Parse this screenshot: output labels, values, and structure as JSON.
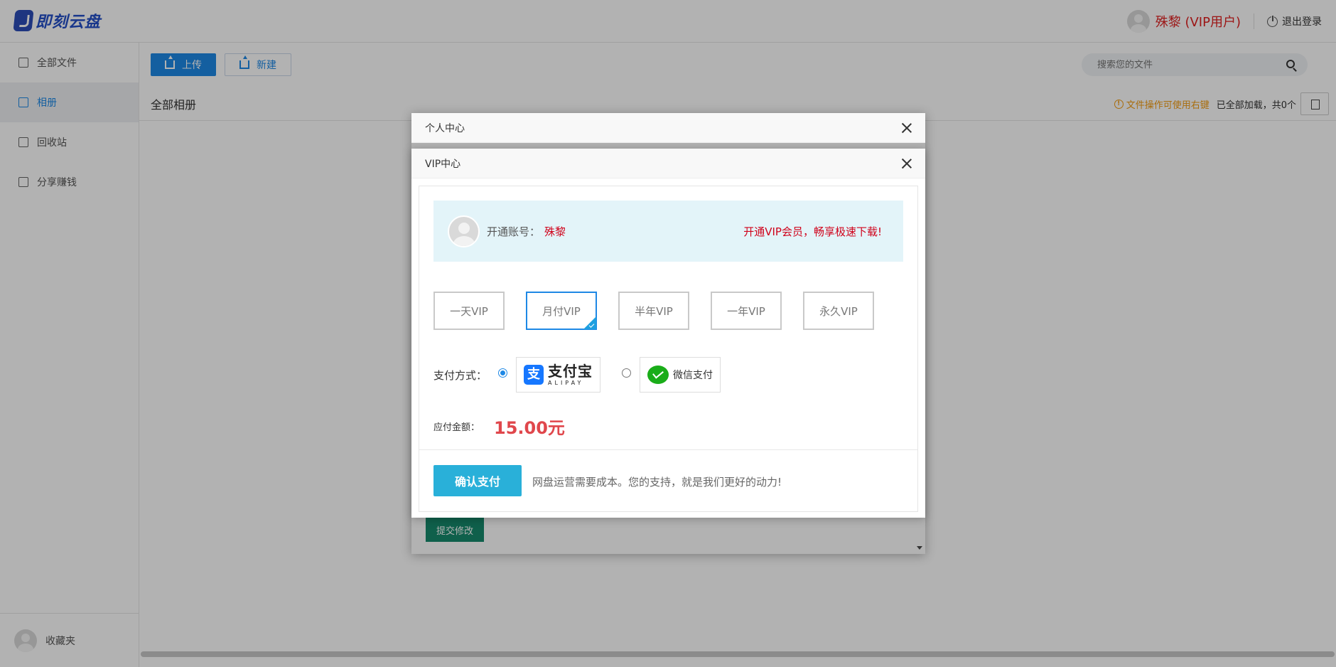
{
  "app": {
    "logo_text": "即刻云盘",
    "username": "殊黎 (VIP用户)",
    "logout_label": "退出登录"
  },
  "sidebar": {
    "items": [
      {
        "label": "全部文件",
        "icon": "files-icon"
      },
      {
        "label": "相册",
        "icon": "monitor-icon"
      },
      {
        "label": "回收站",
        "icon": "trash-icon"
      },
      {
        "label": "分享赚钱",
        "icon": "share-icon"
      }
    ],
    "active_index": 1,
    "bottom_label": "收藏夹"
  },
  "toolbar": {
    "upload_label": "上传",
    "new_label": "新建",
    "search_placeholder": "搜索您的文件"
  },
  "breadcrumb": {
    "current": "全部相册",
    "tip": "文件操作可使用右键",
    "loaded_status": "已全部加载，共0个"
  },
  "outer_modal": {
    "title": "个人中心",
    "submit_label": "提交修改"
  },
  "vip_modal": {
    "title": "VIP中心",
    "account_label": "开通账号：",
    "account_name": "殊黎",
    "slogan": "开通VIP会员，畅享极速下载!",
    "plans": [
      "一天VIP",
      "月付VIP",
      "半年VIP",
      "一年VIP",
      "永久VIP"
    ],
    "selected_plan": "月付VIP",
    "payment_label": "支付方式：",
    "payment_methods": {
      "alipay_cn": "支付宝",
      "alipay_en": "ALIPAY",
      "wechat": "微信支付"
    },
    "selected_payment": "alipay",
    "amount_label": "应付金额：",
    "amount": "15.00元",
    "confirm_label": "确认支付",
    "footer_tip": "网盘运营需要成本。您的支持，就是我们更好的动力!"
  },
  "colors": {
    "primary": "#1e88e5",
    "vip_red": "#d0021b",
    "confirm": "#29b0d9",
    "amount": "#e0474c",
    "submit_green": "#168a6c"
  }
}
